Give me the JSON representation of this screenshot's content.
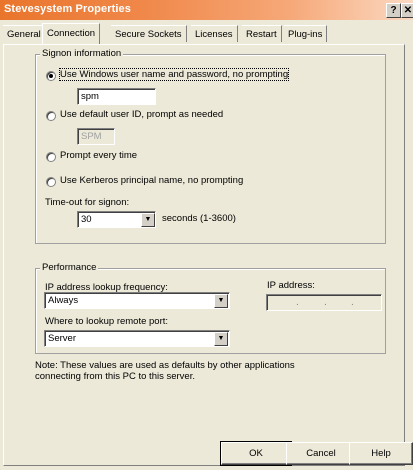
{
  "window": {
    "title": "Stevesystem Properties",
    "help_glyph": "?",
    "close_glyph": "✕"
  },
  "tabs": [
    "General",
    "Connection",
    "Secure Sockets",
    "Licenses",
    "Restart",
    "Plug-ins"
  ],
  "active_tab": "Connection",
  "signon": {
    "legend": "Signon information",
    "opt_windows": "Use Windows user name and password, no prompting",
    "windows_user": "spm",
    "opt_default": "Use default user ID, prompt as needed",
    "default_user": "SPM",
    "opt_prompt": "Prompt every time",
    "opt_kerberos": "Use Kerberos principal name, no prompting",
    "timeout_label": "Time-out for signon:",
    "timeout_value": "30",
    "timeout_units": "seconds (1-3600)"
  },
  "performance": {
    "legend": "Performance",
    "ip_freq_label": "IP address lookup frequency:",
    "ip_freq_value": "Always",
    "ip_address_label": "IP address:",
    "remote_port_label": "Where to lookup remote port:",
    "remote_port_value": "Server"
  },
  "note": "Note: These values are used as defaults by other applications connecting from this PC to this server.",
  "buttons": {
    "ok": "OK",
    "cancel": "Cancel",
    "help": "Help"
  }
}
